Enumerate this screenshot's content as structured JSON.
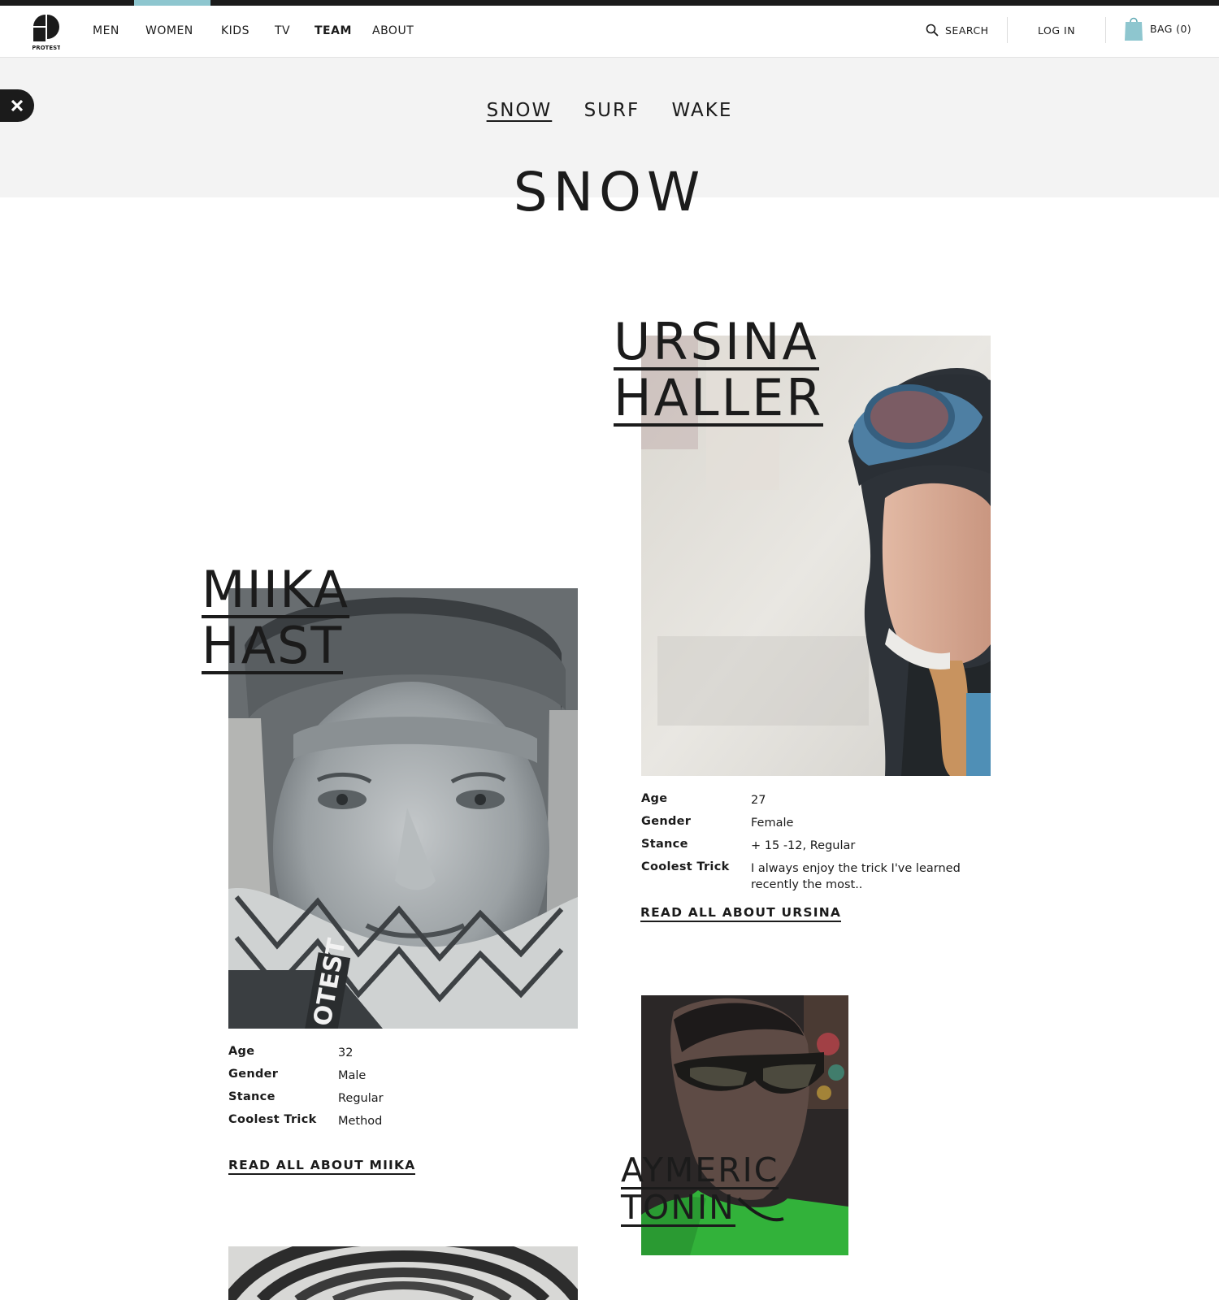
{
  "brand": {
    "logo_text": "PROTEST",
    "accent_color": "#8ec6cf",
    "ink_color": "#1b1b1b"
  },
  "nav": {
    "items": [
      {
        "label": "MEN"
      },
      {
        "label": "WOMEN"
      },
      {
        "label": "KIDS"
      },
      {
        "label": "TV"
      },
      {
        "label": "TEAM",
        "active": true
      },
      {
        "label": "ABOUT"
      }
    ]
  },
  "header": {
    "search_label": "SEARCH",
    "login_label": "LOG IN",
    "bag_label": "BAG (0)"
  },
  "subnav": {
    "items": [
      {
        "label": "SNOW",
        "active": true
      },
      {
        "label": "SURF"
      },
      {
        "label": "WAKE"
      }
    ]
  },
  "page": {
    "title": "SNOW"
  },
  "labels": {
    "age": "Age",
    "gender": "Gender",
    "stance": "Stance",
    "trick": "Coolest Trick"
  },
  "riders": {
    "ursina": {
      "first": "URSINA",
      "last": "HALLER",
      "age": "27",
      "gender": "Female",
      "stance": "+ 15 -12, Regular",
      "trick": "I always enjoy the trick I've learned recently the most..",
      "cta": "READ ALL ABOUT URSINA"
    },
    "miika": {
      "first": "MIIKA",
      "last": "HAST",
      "age": "32",
      "gender": "Male",
      "stance": "Regular",
      "trick": "Method",
      "cta": "READ ALL ABOUT MIIKA",
      "scarf_print": "OTEST"
    },
    "aymeric": {
      "first": "AYMERIC",
      "last": "TONIN"
    }
  }
}
